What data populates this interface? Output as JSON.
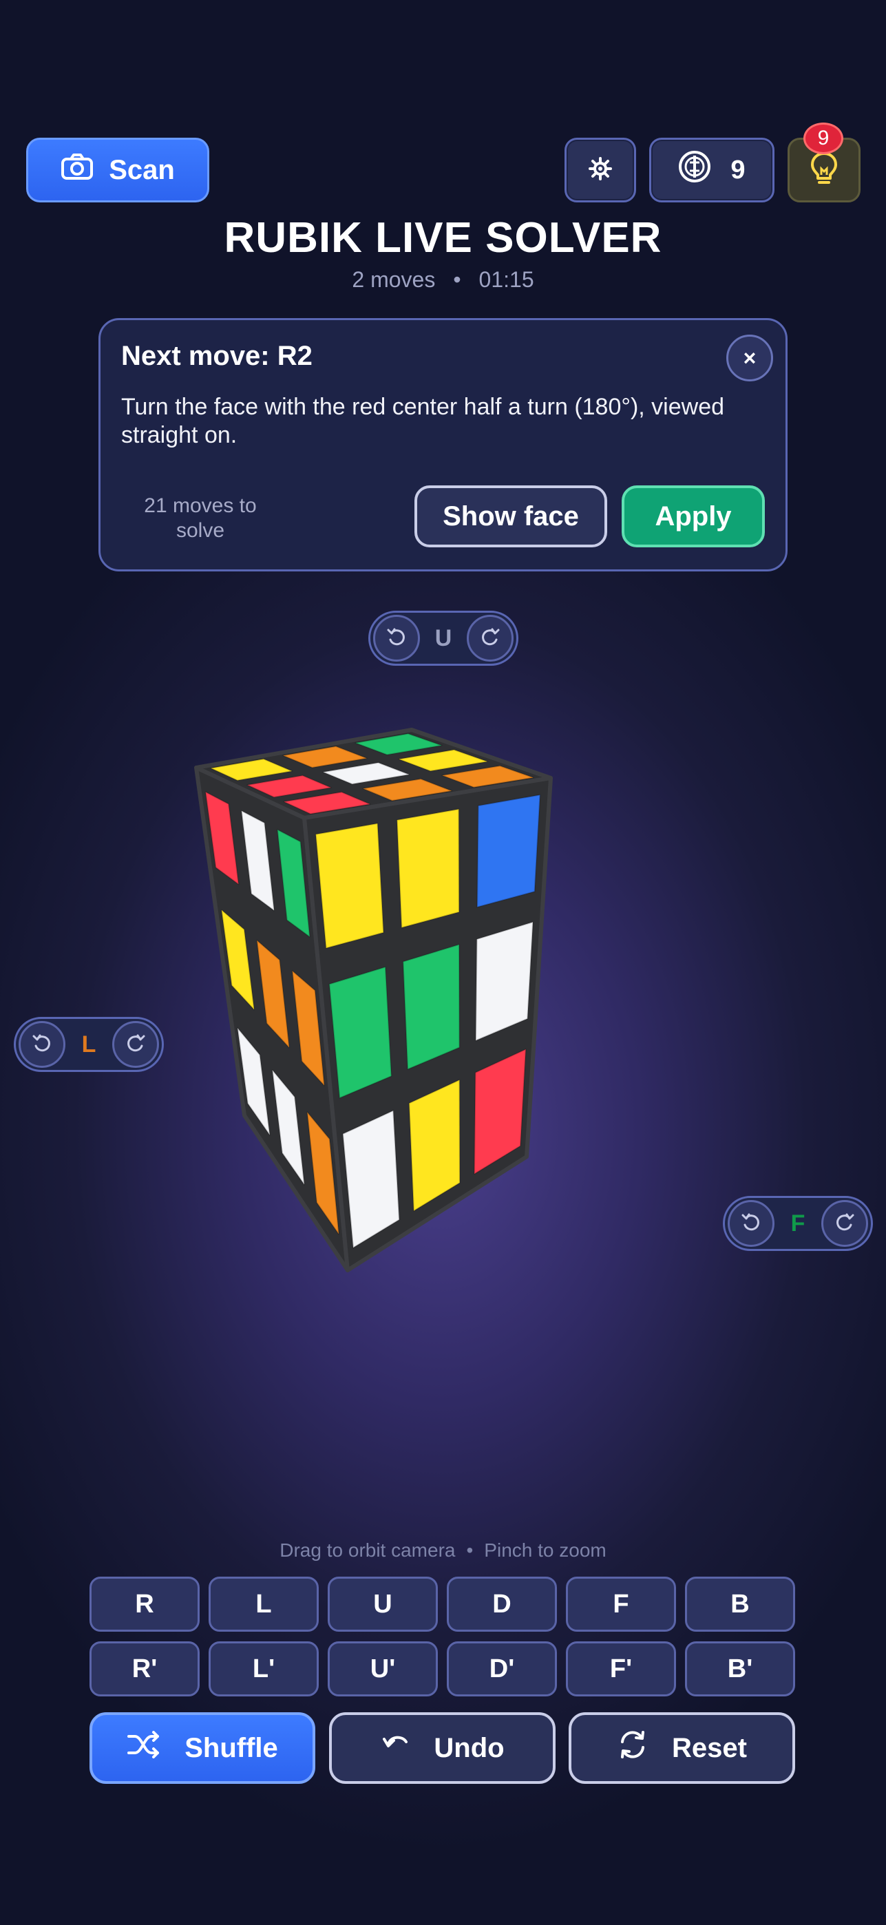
{
  "app": {
    "title": "RUBIK LIVE SOLVER",
    "move_count": "2 moves",
    "separator": "•",
    "timer": "01:15"
  },
  "toolbar": {
    "scan_label": "Scan",
    "coins": "9",
    "hint_badge": "9"
  },
  "hint_card": {
    "title": "Next move: R2",
    "close_label": "×",
    "text": "Turn the face with the red center half a turn (180°), viewed straight on.",
    "moves_left": "21 moves to solve",
    "show_face_label": "Show face",
    "apply_label": "Apply"
  },
  "face_controls": {
    "up": {
      "label": "U",
      "color": "#9aa0c0"
    },
    "left": {
      "label": "L",
      "color": "#e07a1f"
    },
    "front": {
      "label": "F",
      "color": "#109a4a"
    }
  },
  "cube": {
    "colors": {
      "yellow": "#ffe61f",
      "white": "#f4f5f8",
      "green": "#1fc46b",
      "red": "#ff3b4f",
      "orange": "#f28a1e",
      "blue": "#2f75f2"
    },
    "front_face": [
      [
        "yellow",
        "yellow",
        "blue"
      ],
      [
        "green",
        "green",
        "white"
      ],
      [
        "white",
        "yellow",
        "red"
      ]
    ],
    "left_face": [
      [
        "red",
        "white",
        "green"
      ],
      [
        "yellow",
        "orange",
        "orange"
      ],
      [
        "white",
        "white",
        "orange"
      ]
    ],
    "top_face": [
      [
        "yellow",
        "orange",
        "green"
      ],
      [
        "red",
        "white",
        "yellow"
      ],
      [
        "red",
        "orange",
        "orange"
      ]
    ]
  },
  "instructions": {
    "drag": "Drag to orbit camera",
    "separator": "•",
    "pinch": "Pinch to zoom"
  },
  "moves": {
    "row1": [
      "R",
      "L",
      "U",
      "D",
      "F",
      "B"
    ],
    "row2": [
      "R'",
      "L'",
      "U'",
      "D'",
      "F'",
      "B'"
    ]
  },
  "actions": {
    "shuffle_label": "Shuffle",
    "undo_label": "Undo",
    "reset_label": "Reset"
  }
}
